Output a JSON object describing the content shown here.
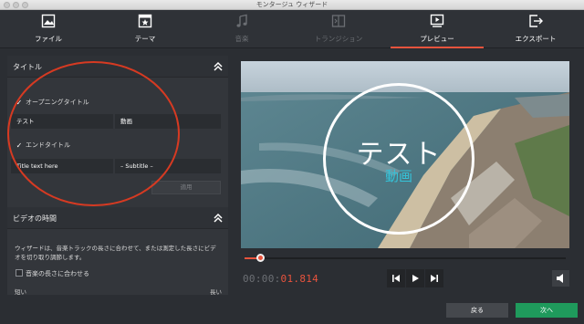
{
  "window": {
    "title": "モンタージュ ウィザード"
  },
  "toolbar": {
    "items": [
      {
        "label": "ファイル",
        "icon": "image-icon",
        "enabled": true,
        "active": false
      },
      {
        "label": "テーマ",
        "icon": "theme-star-icon",
        "enabled": true,
        "active": false
      },
      {
        "label": "音楽",
        "icon": "music-note-icon",
        "enabled": false,
        "active": false
      },
      {
        "label": "トランジション",
        "icon": "transition-icon",
        "enabled": false,
        "active": false
      },
      {
        "label": "プレビュー",
        "icon": "preview-play-icon",
        "enabled": true,
        "active": true
      },
      {
        "label": "エクスポート",
        "icon": "export-icon",
        "enabled": true,
        "active": false
      }
    ]
  },
  "title_section": {
    "header": "タイトル",
    "opening": {
      "label": "オープニングタイトル",
      "checked": true,
      "title_value": "テスト",
      "subtitle_value": "動画"
    },
    "ending": {
      "label": "エンドタイトル",
      "checked": true,
      "title_value": "Title text here",
      "subtitle_value": "– Subtitle –"
    },
    "apply_label": "適用"
  },
  "duration_section": {
    "header": "ビデオの時間",
    "description": "ウィザードは、音楽トラックの長さに合わせて、または測定した長さにビデオを切り取り調節します。",
    "match_music": {
      "label": "音楽の長さに合わせる",
      "checked": false
    },
    "slider_min_label": "短い",
    "slider_max_label": "長い"
  },
  "preview": {
    "overlay_title": "テスト",
    "overlay_subtitle": "動画",
    "timecode_elapsed": "00:00:",
    "timecode_value": "01.814",
    "progress": 0.05
  },
  "colors": {
    "accent": "#e8533d",
    "subtitle_cyan": "#35c2d8",
    "next_button": "#1f9a5c"
  },
  "buttons": {
    "back": "戻る",
    "next": "次へ"
  }
}
